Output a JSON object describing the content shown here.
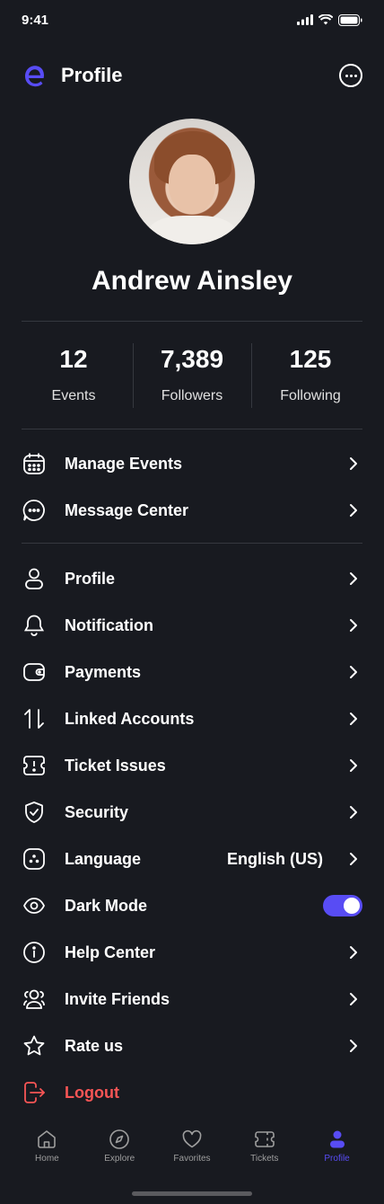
{
  "status_bar": {
    "time": "9:41"
  },
  "header": {
    "title": "Profile",
    "logo_icon": "app-logo-e",
    "more_icon": "more-icon"
  },
  "profile": {
    "name": "Andrew Ainsley"
  },
  "stats": [
    {
      "value": "12",
      "label": "Events"
    },
    {
      "value": "7,389",
      "label": "Followers"
    },
    {
      "value": "125",
      "label": "Following"
    }
  ],
  "menu_primary": [
    {
      "label": "Manage Events",
      "icon": "calendar-icon"
    },
    {
      "label": "Message Center",
      "icon": "chat-icon"
    }
  ],
  "menu_settings": [
    {
      "label": "Profile",
      "icon": "user-icon"
    },
    {
      "label": "Notification",
      "icon": "bell-icon"
    },
    {
      "label": "Payments",
      "icon": "wallet-icon"
    },
    {
      "label": "Linked Accounts",
      "icon": "swap-icon"
    },
    {
      "label": "Ticket Issues",
      "icon": "ticket-icon"
    },
    {
      "label": "Security",
      "icon": "shield-icon"
    },
    {
      "label": "Language",
      "icon": "language-icon",
      "value": "English (US)"
    },
    {
      "label": "Dark Mode",
      "icon": "eye-icon",
      "toggle_on": true
    },
    {
      "label": "Help Center",
      "icon": "info-icon"
    },
    {
      "label": "Invite Friends",
      "icon": "users-icon"
    },
    {
      "label": "Rate us",
      "icon": "star-icon"
    },
    {
      "label": "Logout",
      "icon": "logout-icon"
    }
  ],
  "tabbar": [
    {
      "label": "Home",
      "icon": "home-icon"
    },
    {
      "label": "Explore",
      "icon": "compass-icon"
    },
    {
      "label": "Favorites",
      "icon": "heart-icon"
    },
    {
      "label": "Tickets",
      "icon": "ticket-icon"
    },
    {
      "label": "Profile",
      "icon": "profile-icon",
      "active": true
    }
  ],
  "colors": {
    "background": "#181A20",
    "accent": "#584CF4",
    "danger": "#F75555",
    "divider": "#35383F"
  }
}
